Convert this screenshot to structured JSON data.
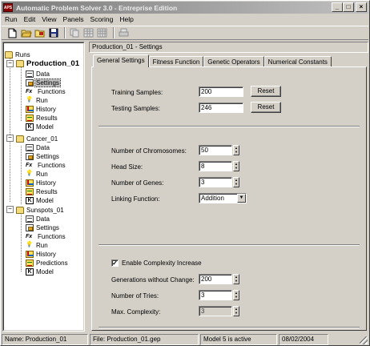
{
  "window": {
    "app_icon_text": "APS",
    "title": "Automatic Problem Solver 3.0 - Entreprise Edition",
    "minimize": "_",
    "maximize": "□",
    "close": "×"
  },
  "menu": [
    "Run",
    "Edit",
    "View",
    "Panels",
    "Scoring",
    "Help"
  ],
  "toolbar": {
    "icons": [
      "new-document-icon",
      "open-folder-icon",
      "open-run-icon",
      "save-icon",
      "copy-icon",
      "grid-icon",
      "table-icon",
      "print-icon"
    ]
  },
  "tree": {
    "root": "Runs",
    "runs": [
      {
        "name": "Production_01",
        "children": [
          {
            "label": "Data",
            "icon": "data-icon"
          },
          {
            "label": "Settings",
            "icon": "settings-icon"
          },
          {
            "label": "Functions",
            "icon": "functions-icon"
          },
          {
            "label": "Run",
            "icon": "run-icon"
          },
          {
            "label": "History",
            "icon": "history-icon"
          },
          {
            "label": "Results",
            "icon": "results-icon"
          },
          {
            "label": "Model",
            "icon": "model-icon"
          }
        ]
      },
      {
        "name": "Cancer_01",
        "children": [
          {
            "label": "Data",
            "icon": "data-icon"
          },
          {
            "label": "Settings",
            "icon": "settings-icon"
          },
          {
            "label": "Functions",
            "icon": "functions-icon"
          },
          {
            "label": "Run",
            "icon": "run-icon"
          },
          {
            "label": "History",
            "icon": "history-icon"
          },
          {
            "label": "Results",
            "icon": "results-icon"
          },
          {
            "label": "Model",
            "icon": "model-icon"
          }
        ]
      },
      {
        "name": "Sunspots_01",
        "children": [
          {
            "label": "Data",
            "icon": "data-icon"
          },
          {
            "label": "Settings",
            "icon": "settings-icon"
          },
          {
            "label": "Functions",
            "icon": "functions-icon"
          },
          {
            "label": "Run",
            "icon": "run-icon"
          },
          {
            "label": "History",
            "icon": "history-icon"
          },
          {
            "label": "Predictions",
            "icon": "predictions-icon"
          },
          {
            "label": "Model",
            "icon": "model-icon"
          }
        ]
      }
    ],
    "fx_glyph": "Fx",
    "model_glyph": "K",
    "expander_glyph": "−"
  },
  "panel": {
    "title": "Production_01 - Settings",
    "tabs": [
      "General Settings",
      "Fitness Function",
      "Genetic Operators",
      "Numerical Constants"
    ]
  },
  "settings": {
    "training_samples_label": "Training Samples:",
    "training_samples_value": "200",
    "testing_samples_label": "Testing Samples:",
    "testing_samples_value": "246",
    "reset_label": "Reset",
    "chromosomes_label": "Number of Chromosomes:",
    "chromosomes_value": "50",
    "head_size_label": "Head Size:",
    "head_size_value": "8",
    "genes_label": "Number of Genes:",
    "genes_value": "3",
    "linking_label": "Linking Function:",
    "linking_value": "Addition",
    "complexity_checkbox_label": "Enable Complexity Increase",
    "complexity_checked": "✓",
    "generations_label": "Generations without Change:",
    "generations_value": "200",
    "tries_label": "Number of Tries:",
    "tries_value": "3",
    "max_complexity_label": "Max. Complexity:",
    "max_complexity_value": "3",
    "spin_up": "▲",
    "spin_down": "▼",
    "dropdown_arrow": "▼"
  },
  "status": {
    "name": "Name: Production_01",
    "file": "File: Production_01.gep",
    "model": "Model 5 is active",
    "date": "08/02/2004"
  }
}
